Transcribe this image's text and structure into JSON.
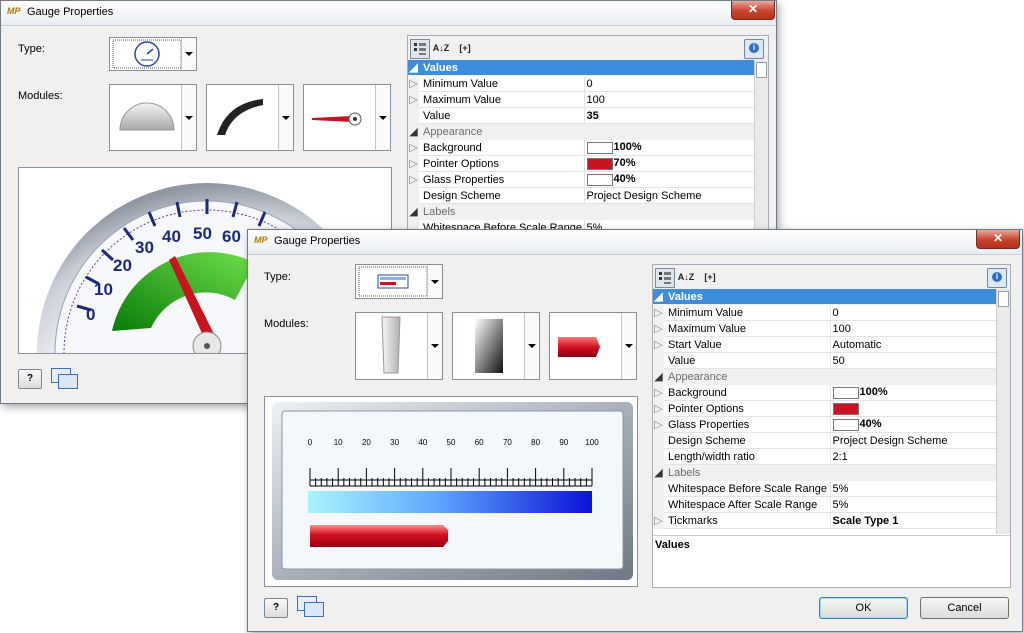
{
  "dialog_back": {
    "app_icon": "MP",
    "title": "Gauge Properties",
    "close": "✕",
    "type_label": "Type:",
    "modules_label": "Modules:",
    "scale_labels": [
      "0",
      "10",
      "20",
      "30",
      "40",
      "50",
      "60"
    ],
    "property_grid": {
      "rows": [
        {
          "kind": "cat",
          "name": "Values",
          "selected": true
        },
        {
          "kind": "prop",
          "expand": true,
          "name": "Minimum Value",
          "value": "0"
        },
        {
          "kind": "prop",
          "expand": true,
          "name": "Maximum Value",
          "value": "100"
        },
        {
          "kind": "prop",
          "expand": false,
          "name": "Value",
          "value": "35",
          "bold": true
        },
        {
          "kind": "cat",
          "name": "Appearance"
        },
        {
          "kind": "prop",
          "expand": true,
          "name": "Background",
          "swatch": "#ffffff",
          "value": "100%",
          "bold": true
        },
        {
          "kind": "prop",
          "expand": true,
          "name": "Pointer Options",
          "swatch": "#c8141e",
          "value": "70%",
          "bold": true
        },
        {
          "kind": "prop",
          "expand": true,
          "name": "Glass Properties",
          "swatch": "#ffffff",
          "value": "40%",
          "bold": true
        },
        {
          "kind": "prop",
          "expand": false,
          "name": "Design Scheme",
          "value": "Project Design Scheme"
        },
        {
          "kind": "cat",
          "name": "Labels"
        },
        {
          "kind": "prop",
          "expand": false,
          "name": "Whitespace Before Scale Range",
          "value": "5%"
        }
      ]
    }
  },
  "dialog_front": {
    "app_icon": "MP",
    "title": "Gauge Properties",
    "close": "✕",
    "type_label": "Type:",
    "modules_label": "Modules:",
    "scale_labels": [
      "0",
      "10",
      "20",
      "30",
      "40",
      "50",
      "60",
      "70",
      "80",
      "90",
      "100"
    ],
    "property_grid": {
      "rows": [
        {
          "kind": "cat",
          "name": "Values",
          "selected": true
        },
        {
          "kind": "prop",
          "expand": true,
          "name": "Minimum Value",
          "value": "0"
        },
        {
          "kind": "prop",
          "expand": true,
          "name": "Maximum Value",
          "value": "100"
        },
        {
          "kind": "prop",
          "expand": true,
          "name": "Start Value",
          "value": "Automatic"
        },
        {
          "kind": "prop",
          "expand": false,
          "name": "Value",
          "value": "50"
        },
        {
          "kind": "cat",
          "name": "Appearance"
        },
        {
          "kind": "prop",
          "expand": true,
          "name": "Background",
          "swatch": "#ffffff",
          "value": "100%",
          "bold": true
        },
        {
          "kind": "prop",
          "expand": true,
          "name": "Pointer Options",
          "swatch": "#c8141e",
          "value": ""
        },
        {
          "kind": "prop",
          "expand": true,
          "name": "Glass Properties",
          "swatch": "#ffffff",
          "value": "40%",
          "bold": true
        },
        {
          "kind": "prop",
          "expand": false,
          "name": "Design Scheme",
          "value": "Project Design Scheme"
        },
        {
          "kind": "prop",
          "expand": false,
          "name": "Length/width ratio",
          "value": "2:1"
        },
        {
          "kind": "cat",
          "name": "Labels"
        },
        {
          "kind": "prop",
          "expand": false,
          "name": "Whitespace Before Scale Range",
          "value": "5%"
        },
        {
          "kind": "prop",
          "expand": false,
          "name": "Whitespace After Scale Range",
          "value": "5%"
        },
        {
          "kind": "prop",
          "expand": true,
          "name": "Tickmarks",
          "value": "Scale Type 1",
          "bold": true
        }
      ]
    },
    "description": "Values",
    "ok_label": "OK",
    "cancel_label": "Cancel"
  },
  "toolbar": {
    "categorized_icon": "categorized-icon",
    "alphabetical_icon": "sort-az-icon",
    "alphabetical_text": "A↓Z",
    "expand_text": "[+]",
    "info_text": "i",
    "help_text": "?"
  },
  "colors": {
    "selection": "#3e8ddd",
    "pointer_red": "#c8141e",
    "gauge_navy": "#1a2a7c"
  }
}
